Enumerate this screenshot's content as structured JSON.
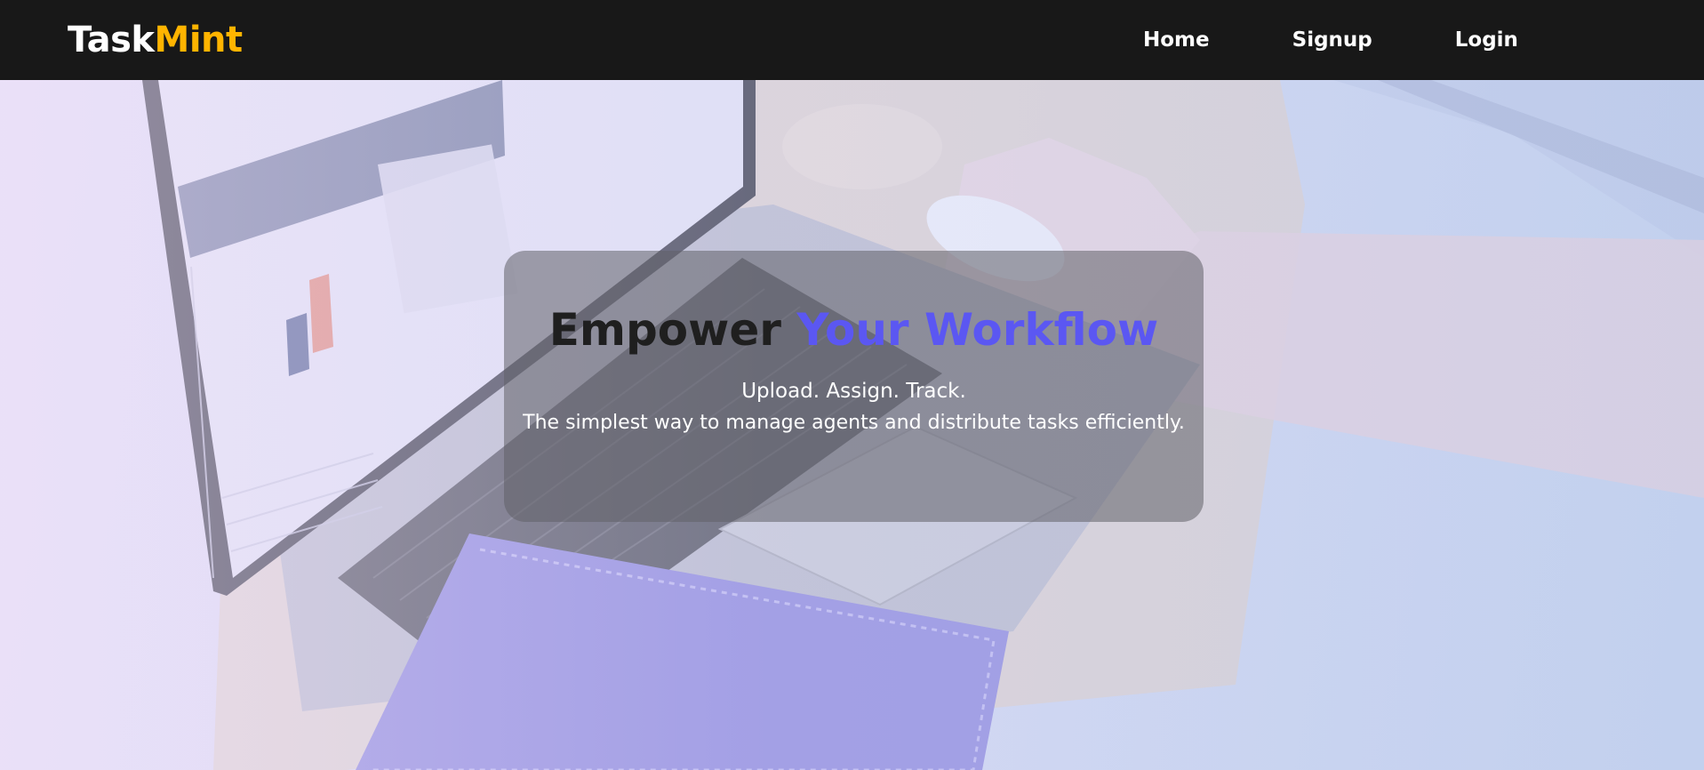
{
  "brand": {
    "name_part1": "Task",
    "name_part2": "Mint",
    "color_primary": "#ffffff",
    "color_accent": "#ffb400"
  },
  "nav": {
    "items": [
      {
        "label": "Home"
      },
      {
        "label": "Signup"
      },
      {
        "label": "Login"
      }
    ]
  },
  "hero": {
    "background_image": "laptop-desk-photo",
    "headline_part1": "Empower",
    "headline_part2": "Your Workflow",
    "headline_accent_color": "#5b57f2",
    "tagline": "Upload. Assign. Track.",
    "description": "The simplest way to manage agents and distribute tasks efficiently."
  }
}
